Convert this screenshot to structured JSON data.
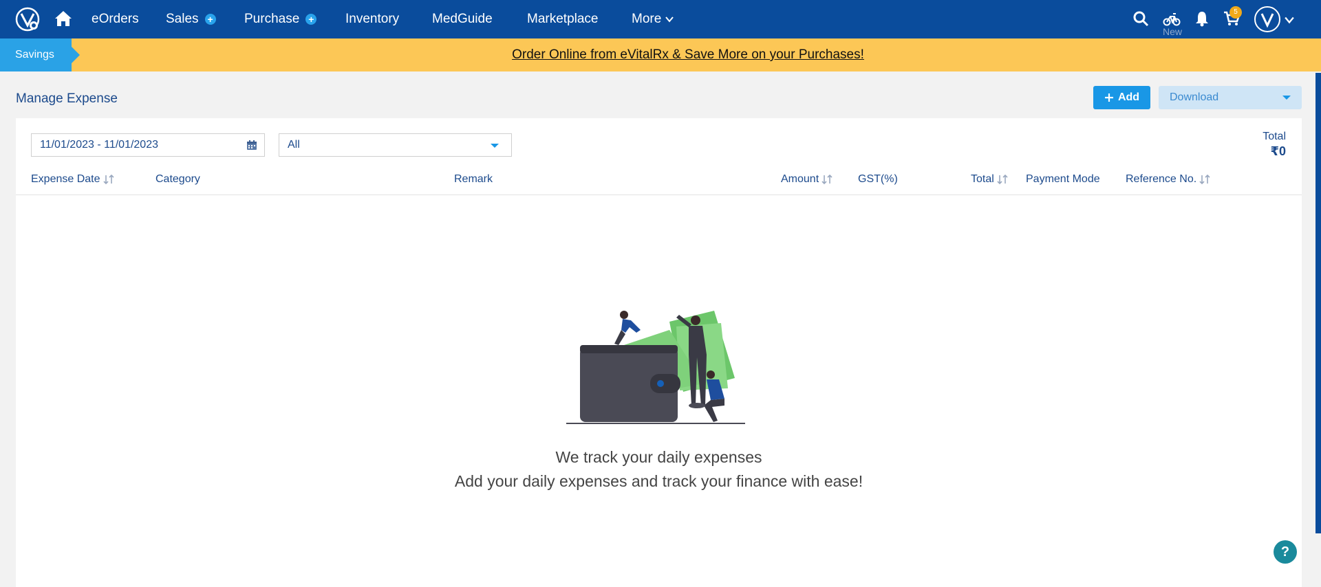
{
  "nav": {
    "items": [
      {
        "label": "eOrders"
      },
      {
        "label": "Sales"
      },
      {
        "label": "Purchase"
      },
      {
        "label": "Inventory"
      },
      {
        "label": "MedGuide"
      },
      {
        "label": "Marketplace"
      },
      {
        "label": "More"
      }
    ],
    "new_label": "New",
    "cart_count": "5"
  },
  "banner": {
    "savings_label": "Savings",
    "promo_text": "Order Online from eVitalRx & Save More on your Purchases!"
  },
  "page": {
    "title": "Manage Expense",
    "add_label": "Add",
    "download_label": "Download"
  },
  "filters": {
    "date_range": "11/01/2023 - 11/01/2023",
    "category_selected": "All"
  },
  "summary": {
    "total_label": "Total",
    "total_value": "₹0"
  },
  "table": {
    "columns": [
      {
        "label": "Expense Date"
      },
      {
        "label": "Category"
      },
      {
        "label": "Remark"
      },
      {
        "label": "Amount"
      },
      {
        "label": "GST(%)"
      },
      {
        "label": "Total"
      },
      {
        "label": "Payment Mode"
      },
      {
        "label": "Reference No."
      }
    ]
  },
  "empty_state": {
    "line1": "We track your daily expenses",
    "line2": "Add your daily expenses and track your finance with ease!"
  },
  "help": {
    "label": "?"
  },
  "colors": {
    "nav_bg": "#0a4c9c",
    "banner_bg": "#fcc756",
    "accent": "#1997e6"
  }
}
